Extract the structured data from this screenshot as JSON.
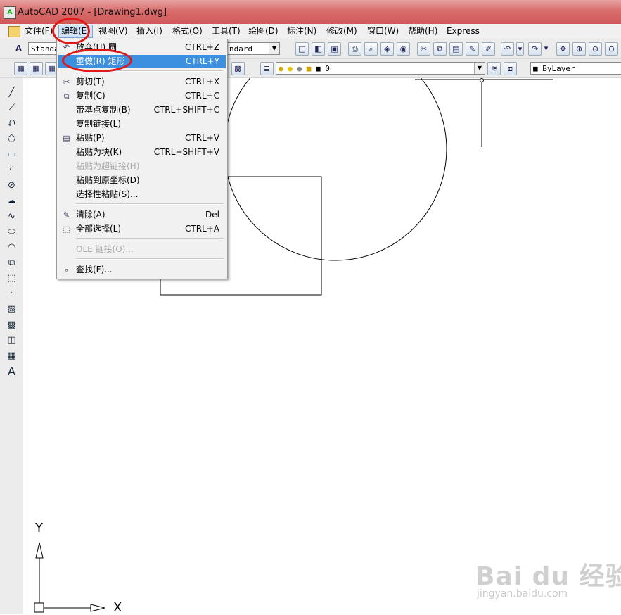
{
  "window": {
    "title": "AutoCAD 2007 - [Drawing1.dwg]",
    "icon": "autocad-app-icon"
  },
  "menubar": {
    "items": [
      "文件(F)",
      "编辑(E)",
      "视图(V)",
      "插入(I)",
      "格式(O)",
      "工具(T)",
      "绘图(D)",
      "标注(N)",
      "修改(M)",
      "窗口(W)",
      "帮助(H)",
      "Express"
    ],
    "active": "编辑(E)"
  },
  "toolbar1": {
    "text_style_value": "Standa",
    "dim_style_value": "ndard"
  },
  "toolbar2": {
    "layer_value": "0",
    "color_value": "ByLayer"
  },
  "edit_menu": {
    "items": [
      {
        "label": "放弃(U) 圆",
        "shortcut": "CTRL+Z"
      },
      {
        "label": "重做(R) 矩形",
        "shortcut": "CTRL+Y",
        "highlighted": true
      },
      {
        "label": "剪切(T)",
        "shortcut": "CTRL+X"
      },
      {
        "label": "复制(C)",
        "shortcut": "CTRL+C"
      },
      {
        "label": "带基点复制(B)",
        "shortcut": "CTRL+SHIFT+C"
      },
      {
        "label": "复制链接(L)",
        "shortcut": ""
      },
      {
        "label": "粘贴(P)",
        "shortcut": "CTRL+V"
      },
      {
        "label": "粘贴为块(K)",
        "shortcut": "CTRL+SHIFT+V"
      },
      {
        "label": "粘贴为超链接(H)",
        "shortcut": "",
        "disabled": true
      },
      {
        "label": "粘贴到原坐标(D)",
        "shortcut": ""
      },
      {
        "label": "选择性粘贴(S)...",
        "shortcut": ""
      },
      {
        "label": "清除(A)",
        "shortcut": "Del"
      },
      {
        "label": "全部选择(L)",
        "shortcut": "CTRL+A"
      },
      {
        "label": "OLE 链接(O)...",
        "shortcut": "",
        "disabled": true
      },
      {
        "label": "查找(F)...",
        "shortcut": ""
      }
    ]
  },
  "ucs": {
    "x_label": "X",
    "y_label": "Y"
  },
  "watermark": {
    "brand": "Bai du 经验",
    "url": "jingyan.baidu.com"
  },
  "colors": {
    "title_bar": "#d96c6c",
    "highlight": "#3d8fe0",
    "annotation": "#e01818"
  }
}
